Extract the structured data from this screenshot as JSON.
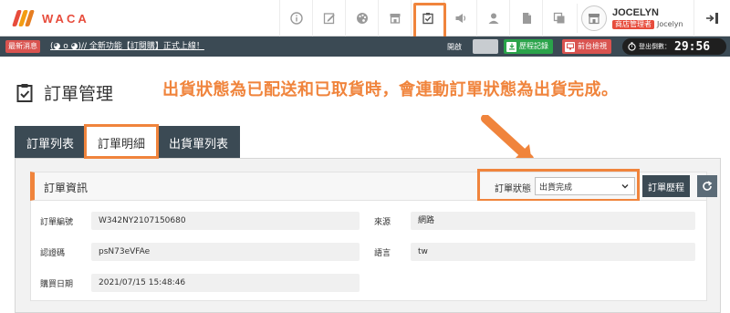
{
  "brand": {
    "name": "WACA"
  },
  "topbar": {
    "icons": [
      "info-icon",
      "edit-icon",
      "palette-icon",
      "store-icon",
      "order-check-icon",
      "megaphone-icon",
      "user-icon",
      "document-icon",
      "copy-icon"
    ],
    "active_icon": "order-check-icon",
    "user": {
      "name": "JOCELYN",
      "role": "商店管理者",
      "username": "Jocelyn"
    },
    "logout_icon": "logout-icon"
  },
  "newsbar": {
    "badge": "最新消息",
    "text": "(◕ o ◕)// 全新功能【訂閱購】正式上線！",
    "open_label": "開啟",
    "history_button": "歷程記錄",
    "front_button": "前台檢視",
    "timer_label": "登出倒數：",
    "timer_value": "29:56"
  },
  "page": {
    "title": "訂單管理",
    "annotation": "出貨狀態為已配送和已取貨時，會連動訂單狀態為出貨完成。"
  },
  "tabs": [
    {
      "label": "訂單列表",
      "active": false
    },
    {
      "label": "訂單明細",
      "active": true
    },
    {
      "label": "出貨單列表",
      "active": false
    }
  ],
  "order_info": {
    "title": "訂單資訊",
    "status_label": "訂單狀態",
    "status_value": "出貨完成",
    "history_button": "訂單歷程",
    "fields": {
      "order_no_label": "訂單編號",
      "order_no": "W342NY2107150680",
      "source_label": "來源",
      "source": "網路",
      "auth_code_label": "認證碼",
      "auth_code": "psN73eVFAe",
      "language_label": "語言",
      "language": "tw",
      "purchase_date_label": "購買日期",
      "purchase_date": "2021/07/15 15:48:46"
    }
  },
  "colors": {
    "accent": "#f0843c",
    "dark": "#3b4a54",
    "brand_red": "#e74c3c",
    "green": "#2aa34a",
    "red": "#d9534f"
  }
}
